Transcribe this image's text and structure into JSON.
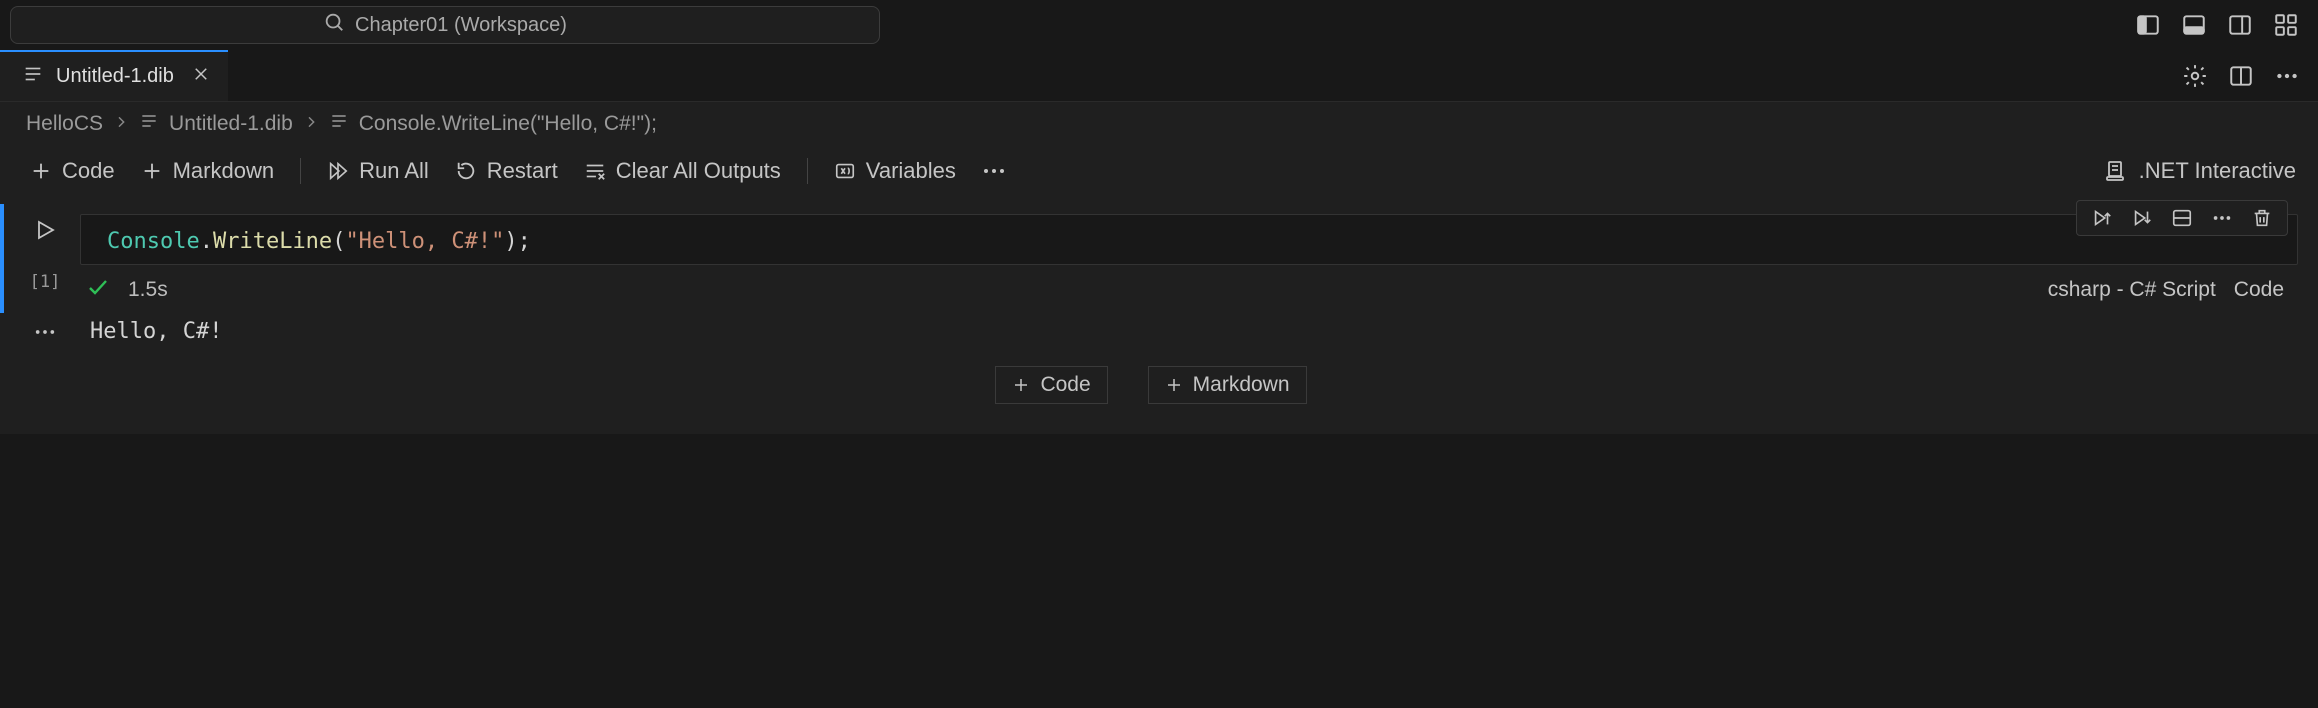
{
  "titlebar": {
    "workspace_label": "Chapter01 (Workspace)"
  },
  "tab": {
    "filename": "Untitled-1.dib"
  },
  "breadcrumb": {
    "segments": {
      "0": "HelloCS",
      "1": "Untitled-1.dib",
      "2": "Console.WriteLine(\"Hello, C#!\");"
    }
  },
  "toolbar": {
    "add_code": "Code",
    "add_markdown": "Markdown",
    "run_all": "Run All",
    "restart": "Restart",
    "clear_outputs": "Clear All Outputs",
    "variables": "Variables",
    "kernel": ".NET Interactive"
  },
  "cell": {
    "code_tokens": {
      "type": "Console",
      "dot": ".",
      "func": "WriteLine",
      "open": "(",
      "str": "\"Hello, C#!\"",
      "close": ")",
      "semi": ";"
    },
    "exec_count": "[1]",
    "duration": "1.5s",
    "language": "csharp - C# Script",
    "kind": "Code",
    "output": "Hello, C#!"
  },
  "add": {
    "code": "Code",
    "markdown": "Markdown"
  }
}
